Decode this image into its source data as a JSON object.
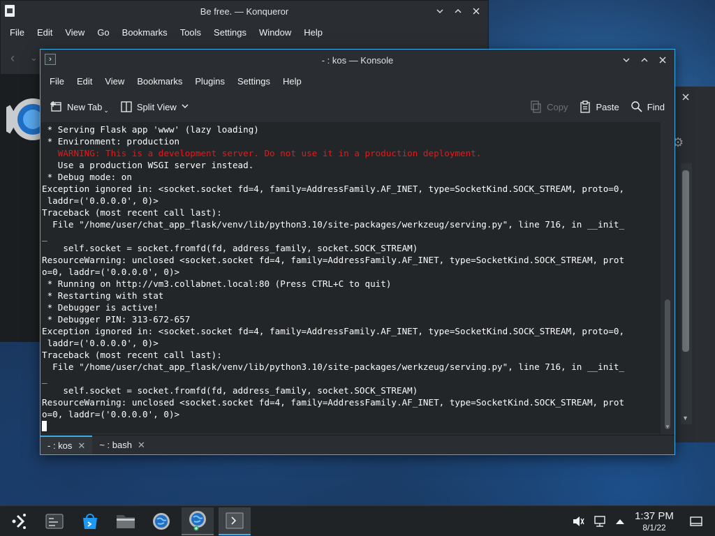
{
  "konqueror": {
    "title": "Be free. — Konqueror",
    "menu": [
      "File",
      "Edit",
      "View",
      "Go",
      "Bookmarks",
      "Tools",
      "Settings",
      "Window",
      "Help"
    ]
  },
  "konsole": {
    "title": "- : kos — Konsole",
    "menu": [
      "File",
      "Edit",
      "View",
      "Bookmarks",
      "Plugins",
      "Settings",
      "Help"
    ],
    "toolbar": {
      "new_tab": "New Tab",
      "split_view": "Split View",
      "copy": "Copy",
      "paste": "Paste",
      "find": "Find"
    },
    "terminal_lines": [
      {
        "text": " * Serving Flask app 'www' (lazy loading)",
        "style": "normal"
      },
      {
        "text": " * Environment: production",
        "style": "normal"
      },
      {
        "text": "   WARNING: This is a development server. Do not use it in a production deployment.",
        "style": "warn"
      },
      {
        "text": "   Use a production WSGI server instead.",
        "style": "normal"
      },
      {
        "text": " * Debug mode: on",
        "style": "normal"
      },
      {
        "text": "Exception ignored in: <socket.socket fd=4, family=AddressFamily.AF_INET, type=SocketKind.SOCK_STREAM, proto=0,",
        "style": "normal"
      },
      {
        "text": " laddr=('0.0.0.0', 0)>",
        "style": "normal"
      },
      {
        "text": "Traceback (most recent call last):",
        "style": "normal"
      },
      {
        "text": "  File \"/home/user/chat_app_flask/venv/lib/python3.10/site-packages/werkzeug/serving.py\", line 716, in __init_",
        "style": "normal"
      },
      {
        "text": "_",
        "style": "normal"
      },
      {
        "text": "    self.socket = socket.fromfd(fd, address_family, socket.SOCK_STREAM)",
        "style": "normal"
      },
      {
        "text": "ResourceWarning: unclosed <socket.socket fd=4, family=AddressFamily.AF_INET, type=SocketKind.SOCK_STREAM, prot",
        "style": "normal"
      },
      {
        "text": "o=0, laddr=('0.0.0.0', 0)>",
        "style": "normal"
      },
      {
        "text": " * Running on http://vm3.collabnet.local:80 (Press CTRL+C to quit)",
        "style": "normal"
      },
      {
        "text": " * Restarting with stat",
        "style": "normal"
      },
      {
        "text": " * Debugger is active!",
        "style": "normal"
      },
      {
        "text": " * Debugger PIN: 313-672-657",
        "style": "normal"
      },
      {
        "text": "Exception ignored in: <socket.socket fd=4, family=AddressFamily.AF_INET, type=SocketKind.SOCK_STREAM, proto=0,",
        "style": "normal"
      },
      {
        "text": " laddr=('0.0.0.0', 0)>",
        "style": "normal"
      },
      {
        "text": "Traceback (most recent call last):",
        "style": "normal"
      },
      {
        "text": "  File \"/home/user/chat_app_flask/venv/lib/python3.10/site-packages/werkzeug/serving.py\", line 716, in __init_",
        "style": "normal"
      },
      {
        "text": "_",
        "style": "normal"
      },
      {
        "text": "    self.socket = socket.fromfd(fd, address_family, socket.SOCK_STREAM)",
        "style": "normal"
      },
      {
        "text": "ResourceWarning: unclosed <socket.socket fd=4, family=AddressFamily.AF_INET, type=SocketKind.SOCK_STREAM, prot",
        "style": "normal"
      },
      {
        "text": "o=0, laddr=('0.0.0.0', 0)>",
        "style": "normal"
      }
    ],
    "tabs": [
      {
        "label": "- : kos",
        "active": true
      },
      {
        "label": "~ : bash",
        "active": false
      }
    ]
  },
  "taskbar": {
    "apps": [
      {
        "icon": "app-launcher-icon"
      },
      {
        "icon": "task-switcher-icon"
      },
      {
        "icon": "discover-store-icon"
      },
      {
        "icon": "dolphin-folder-icon"
      },
      {
        "icon": "konqueror-globe-icon"
      },
      {
        "icon": "konqueror-globe-icon"
      },
      {
        "icon": "konsole-terminal-icon"
      }
    ],
    "clock": {
      "time": "1:37 PM",
      "date": "8/1/22"
    }
  },
  "colors": {
    "accent": "#3daee9",
    "terminal_bg": "#232629",
    "warning_text": "#ed1515",
    "window_bg": "#2a2e32"
  }
}
